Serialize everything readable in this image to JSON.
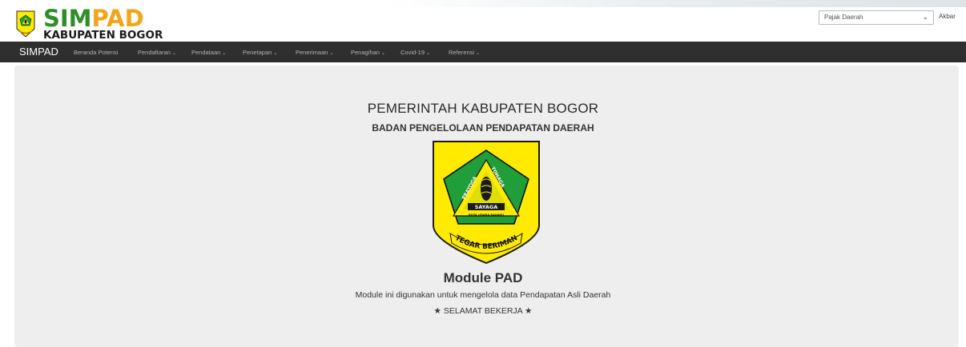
{
  "header": {
    "brand_main_1": "SIM",
    "brand_main_2": "PAD",
    "brand_sub": "KABUPATEN BOGOR",
    "tax_select_value": "Pajak Daerah",
    "user_name": "Akbar"
  },
  "navbar": {
    "brand": "SIMPAD",
    "items": [
      {
        "label": "Beranda Potensi",
        "dropdown": false
      },
      {
        "label": "Pendaftaran",
        "dropdown": true
      },
      {
        "label": "Pendataan",
        "dropdown": true
      },
      {
        "label": "Penetapan",
        "dropdown": true
      },
      {
        "label": "Penerimaan",
        "dropdown": true
      },
      {
        "label": "Penagihan",
        "dropdown": true
      },
      {
        "label": "Covid-19",
        "dropdown": true
      },
      {
        "label": "Referensi",
        "dropdown": true
      }
    ],
    "caret": "⌄"
  },
  "main": {
    "gov_title": "PEMERINTAH KABUPATEN BOGOR",
    "agency_title": "BADAN PENGELOLAAN PENDAPATAN DAERAH",
    "emblem_texts": {
      "left_arc": "PRAYOGA",
      "right_arc": "TOHAGA",
      "center": "SAYAGA",
      "band": "KOTA UDARA RAHAYU",
      "ribbon": "TEGAR BERIMAN"
    },
    "module_title": "Module PAD",
    "module_desc": "Module ini digunakan untuk mengelola data Pendapatan Asli Daerah",
    "greeting": "★ SELAMAT BEKERJA ★"
  },
  "colors": {
    "navbar_bg": "#2f2f2f",
    "brand_green": "#2e8f2a",
    "brand_orange": "#f2a51a",
    "emblem_yellow": "#ffea00",
    "emblem_green": "#1f9e3a",
    "jumbotron_bg": "#eeeeee"
  }
}
